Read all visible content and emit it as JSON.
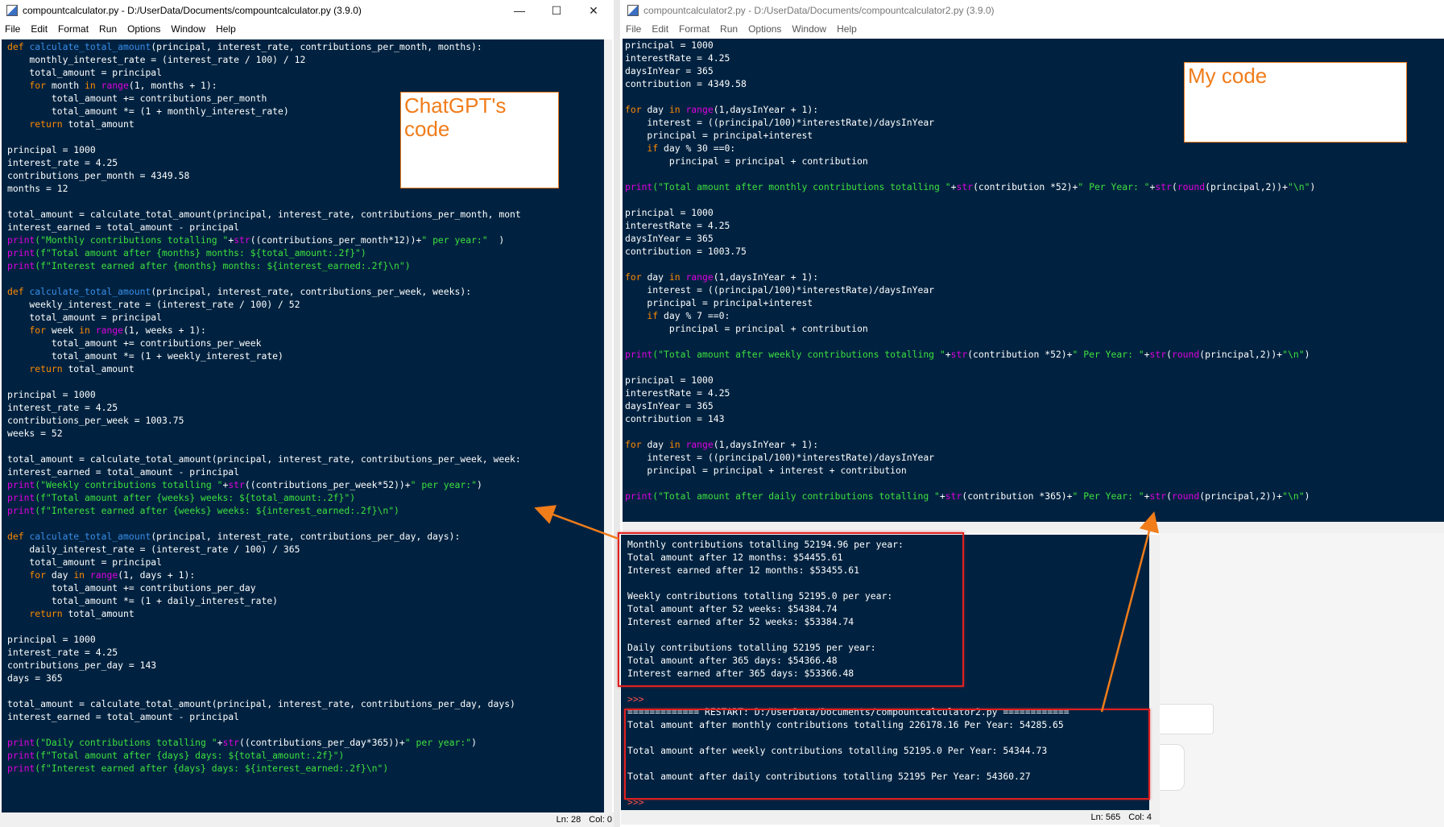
{
  "left_window": {
    "title": "compountcalculator.py - D:/UserData/Documents/compountcalculator.py (3.9.0)",
    "controls": [
      "—",
      "☐",
      "✕"
    ],
    "menu": [
      "File",
      "Edit",
      "Format",
      "Run",
      "Options",
      "Window",
      "Help"
    ],
    "status": {
      "line": "Ln: 28",
      "col": "Col: 0"
    }
  },
  "right_window": {
    "title": "compountcalculator2.py - D:/UserData/Documents/compountcalculator2.py (3.9.0)",
    "menu": [
      "File",
      "Edit",
      "Format",
      "Run",
      "Options",
      "Window",
      "Help"
    ]
  },
  "shell": {
    "status": {
      "line": "Ln: 565",
      "col": "Col: 4"
    }
  },
  "annotations": {
    "chatgpt_label": "ChatGPT's\ncode",
    "my_code_label": "My code"
  },
  "colors": {
    "editor_bg": "#002240",
    "keyword": "#ff8a00",
    "builtin": "#e000e0",
    "function": "#3a8de8",
    "string": "#3ee03e",
    "annotation": "#f07c1a",
    "highlight_box": "#e02020"
  },
  "left_code": [
    [
      [
        "kw",
        "def "
      ],
      [
        "fn",
        "calculate_total_amount"
      ],
      [
        "",
        "(principal, interest_rate, contributions_per_month, months):"
      ]
    ],
    [
      [
        "",
        "    monthly_interest_rate = (interest_rate / 100) / 12"
      ]
    ],
    [
      [
        "",
        "    total_amount = principal"
      ]
    ],
    [
      [
        "kw",
        "    for "
      ],
      [
        "",
        "month "
      ],
      [
        "kw",
        "in "
      ],
      [
        "bi",
        "range"
      ],
      [
        "",
        "(1, months + 1):"
      ]
    ],
    [
      [
        "",
        "        total_amount += contributions_per_month"
      ]
    ],
    [
      [
        "",
        "        total_amount *= (1 + monthly_interest_rate)"
      ]
    ],
    [
      [
        "kw",
        "    return "
      ],
      [
        "",
        "total_amount"
      ]
    ],
    [
      [
        "",
        ""
      ]
    ],
    [
      [
        "",
        "principal = 1000"
      ]
    ],
    [
      [
        "",
        "interest_rate = 4.25"
      ]
    ],
    [
      [
        "",
        "contributions_per_month = 4349.58"
      ]
    ],
    [
      [
        "",
        "months = 12"
      ]
    ],
    [
      [
        "",
        ""
      ]
    ],
    [
      [
        "",
        "total_amount = calculate_total_amount(principal, interest_rate, contributions_per_month, mont"
      ]
    ],
    [
      [
        "",
        "interest_earned = total_amount - principal"
      ]
    ],
    [
      [
        "bi",
        "print"
      ],
      [
        "str",
        "(\"Monthly contributions totalling \""
      ],
      [
        "",
        "+"
      ],
      [
        "bi",
        "str"
      ],
      [
        "",
        "((contributions_per_month*12))+"
      ],
      [
        "str",
        "\" per year:\""
      ],
      [
        "",
        "  )"
      ]
    ],
    [
      [
        "bi",
        "print"
      ],
      [
        "str",
        "(f\"Total amount after {months} months: ${total_amount:.2f}\")"
      ]
    ],
    [
      [
        "bi",
        "print"
      ],
      [
        "str",
        "(f\"Interest earned after {months} months: ${interest_earned:.2f}\\n\")"
      ]
    ],
    [
      [
        "",
        ""
      ]
    ],
    [
      [
        "kw",
        "def "
      ],
      [
        "fn",
        "calculate_total_amount"
      ],
      [
        "",
        "(principal, interest_rate, contributions_per_week, weeks):"
      ]
    ],
    [
      [
        "",
        "    weekly_interest_rate = (interest_rate / 100) / 52"
      ]
    ],
    [
      [
        "",
        "    total_amount = principal"
      ]
    ],
    [
      [
        "kw",
        "    for "
      ],
      [
        "",
        "week "
      ],
      [
        "kw",
        "in "
      ],
      [
        "bi",
        "range"
      ],
      [
        "",
        "(1, weeks + 1):"
      ]
    ],
    [
      [
        "",
        "        total_amount += contributions_per_week"
      ]
    ],
    [
      [
        "",
        "        total_amount *= (1 + weekly_interest_rate)"
      ]
    ],
    [
      [
        "kw",
        "    return "
      ],
      [
        "",
        "total_amount"
      ]
    ],
    [
      [
        "",
        ""
      ]
    ],
    [
      [
        "",
        "principal = 1000"
      ]
    ],
    [
      [
        "",
        "interest_rate = 4.25"
      ]
    ],
    [
      [
        "",
        "contributions_per_week = 1003.75"
      ]
    ],
    [
      [
        "",
        "weeks = 52"
      ]
    ],
    [
      [
        "",
        ""
      ]
    ],
    [
      [
        "",
        "total_amount = calculate_total_amount(principal, interest_rate, contributions_per_week, week:"
      ]
    ],
    [
      [
        "",
        "interest_earned = total_amount - principal"
      ]
    ],
    [
      [
        "bi",
        "print"
      ],
      [
        "str",
        "(\"Weekly contributions totalling \""
      ],
      [
        "",
        "+"
      ],
      [
        "bi",
        "str"
      ],
      [
        "",
        "((contributions_per_week*52))+"
      ],
      [
        "str",
        "\" per year:\""
      ],
      [
        "",
        ")"
      ]
    ],
    [
      [
        "bi",
        "print"
      ],
      [
        "str",
        "(f\"Total amount after {weeks} weeks: ${total_amount:.2f}\")"
      ]
    ],
    [
      [
        "bi",
        "print"
      ],
      [
        "str",
        "(f\"Interest earned after {weeks} weeks: ${interest_earned:.2f}\\n\")"
      ]
    ],
    [
      [
        "",
        ""
      ]
    ],
    [
      [
        "kw",
        "def "
      ],
      [
        "fn",
        "calculate_total_amount"
      ],
      [
        "",
        "(principal, interest_rate, contributions_per_day, days):"
      ]
    ],
    [
      [
        "",
        "    daily_interest_rate = (interest_rate / 100) / 365"
      ]
    ],
    [
      [
        "",
        "    total_amount = principal"
      ]
    ],
    [
      [
        "kw",
        "    for "
      ],
      [
        "",
        "day "
      ],
      [
        "kw",
        "in "
      ],
      [
        "bi",
        "range"
      ],
      [
        "",
        "(1, days + 1):"
      ]
    ],
    [
      [
        "",
        "        total_amount += contributions_per_day"
      ]
    ],
    [
      [
        "",
        "        total_amount *= (1 + daily_interest_rate)"
      ]
    ],
    [
      [
        "kw",
        "    return "
      ],
      [
        "",
        "total_amount"
      ]
    ],
    [
      [
        "",
        ""
      ]
    ],
    [
      [
        "",
        "principal = 1000"
      ]
    ],
    [
      [
        "",
        "interest_rate = 4.25"
      ]
    ],
    [
      [
        "",
        "contributions_per_day = 143"
      ]
    ],
    [
      [
        "",
        "days = 365"
      ]
    ],
    [
      [
        "",
        ""
      ]
    ],
    [
      [
        "",
        "total_amount = calculate_total_amount(principal, interest_rate, contributions_per_day, days)"
      ]
    ],
    [
      [
        "",
        "interest_earned = total_amount - principal"
      ]
    ],
    [
      [
        "",
        ""
      ]
    ],
    [
      [
        "bi",
        "print"
      ],
      [
        "str",
        "(\"Daily contributions totalling \""
      ],
      [
        "",
        "+"
      ],
      [
        "bi",
        "str"
      ],
      [
        "",
        "((contributions_per_day*365))+"
      ],
      [
        "str",
        "\" per year:\""
      ],
      [
        "",
        ")"
      ]
    ],
    [
      [
        "bi",
        "print"
      ],
      [
        "str",
        "(f\"Total amount after {days} days: ${total_amount:.2f}\")"
      ]
    ],
    [
      [
        "bi",
        "print"
      ],
      [
        "str",
        "(f\"Interest earned after {days} days: ${interest_earned:.2f}\\n\")"
      ]
    ]
  ],
  "right_code": [
    [
      [
        "",
        "principal = 1000"
      ]
    ],
    [
      [
        "",
        "interestRate = 4.25"
      ]
    ],
    [
      [
        "",
        "daysInYear = 365"
      ]
    ],
    [
      [
        "",
        "contribution = 4349.58"
      ]
    ],
    [
      [
        "",
        ""
      ]
    ],
    [
      [
        "kw",
        "for "
      ],
      [
        "",
        "day "
      ],
      [
        "kw",
        "in "
      ],
      [
        "bi",
        "range"
      ],
      [
        "",
        "(1,daysInYear + 1):"
      ]
    ],
    [
      [
        "",
        "    interest = ((principal/100)*interestRate)/daysInYear"
      ]
    ],
    [
      [
        "",
        "    principal = principal+interest"
      ]
    ],
    [
      [
        "kw",
        "    if "
      ],
      [
        "",
        "day % 30 ==0:"
      ]
    ],
    [
      [
        "",
        "        principal = principal + contribution"
      ]
    ],
    [
      [
        "",
        ""
      ]
    ],
    [
      [
        "bi",
        "print"
      ],
      [
        "str",
        "(\"Total amount after monthly contributions totalling \""
      ],
      [
        "",
        "+"
      ],
      [
        "bi",
        "str"
      ],
      [
        "",
        "(contribution *52)+"
      ],
      [
        "str",
        "\" Per Year: \""
      ],
      [
        "",
        "+"
      ],
      [
        "bi",
        "str"
      ],
      [
        "",
        "("
      ],
      [
        "bi",
        "round"
      ],
      [
        "",
        "(principal,2))+"
      ],
      [
        "str",
        "\"\\n\""
      ],
      [
        "",
        ")"
      ]
    ],
    [
      [
        "",
        ""
      ]
    ],
    [
      [
        "",
        "principal = 1000"
      ]
    ],
    [
      [
        "",
        "interestRate = 4.25"
      ]
    ],
    [
      [
        "",
        "daysInYear = 365"
      ]
    ],
    [
      [
        "",
        "contribution = 1003.75"
      ]
    ],
    [
      [
        "",
        ""
      ]
    ],
    [
      [
        "kw",
        "for "
      ],
      [
        "",
        "day "
      ],
      [
        "kw",
        "in "
      ],
      [
        "bi",
        "range"
      ],
      [
        "",
        "(1,daysInYear + 1):"
      ]
    ],
    [
      [
        "",
        "    interest = ((principal/100)*interestRate)/daysInYear"
      ]
    ],
    [
      [
        "",
        "    principal = principal+interest"
      ]
    ],
    [
      [
        "kw",
        "    if "
      ],
      [
        "",
        "day % 7 ==0:"
      ]
    ],
    [
      [
        "",
        "        principal = principal + contribution"
      ]
    ],
    [
      [
        "",
        ""
      ]
    ],
    [
      [
        "bi",
        "print"
      ],
      [
        "str",
        "(\"Total amount after weekly contributions totalling \""
      ],
      [
        "",
        "+"
      ],
      [
        "bi",
        "str"
      ],
      [
        "",
        "(contribution *52)+"
      ],
      [
        "str",
        "\" Per Year: \""
      ],
      [
        "",
        "+"
      ],
      [
        "bi",
        "str"
      ],
      [
        "",
        "("
      ],
      [
        "bi",
        "round"
      ],
      [
        "",
        "(principal,2))+"
      ],
      [
        "str",
        "\"\\n\""
      ],
      [
        "",
        ")"
      ]
    ],
    [
      [
        "",
        ""
      ]
    ],
    [
      [
        "",
        "principal = 1000"
      ]
    ],
    [
      [
        "",
        "interestRate = 4.25"
      ]
    ],
    [
      [
        "",
        "daysInYear = 365"
      ]
    ],
    [
      [
        "",
        "contribution = 143"
      ]
    ],
    [
      [
        "",
        ""
      ]
    ],
    [
      [
        "kw",
        "for "
      ],
      [
        "",
        "day "
      ],
      [
        "kw",
        "in "
      ],
      [
        "bi",
        "range"
      ],
      [
        "",
        "(1,daysInYear + 1):"
      ]
    ],
    [
      [
        "",
        "    interest = ((principal/100)*interestRate)/daysInYear"
      ]
    ],
    [
      [
        "",
        "    principal = principal + interest + contribution"
      ]
    ],
    [
      [
        "",
        ""
      ]
    ],
    [
      [
        "bi",
        "print"
      ],
      [
        "str",
        "(\"Total amount after daily contributions totalling \""
      ],
      [
        "",
        "+"
      ],
      [
        "bi",
        "str"
      ],
      [
        "",
        "(contribution *365)+"
      ],
      [
        "str",
        "\" Per Year: \""
      ],
      [
        "",
        "+"
      ],
      [
        "bi",
        "str"
      ],
      [
        "",
        "("
      ],
      [
        "bi",
        "round"
      ],
      [
        "",
        "(principal,2))+"
      ],
      [
        "str",
        "\"\\n\""
      ],
      [
        "",
        ")"
      ]
    ]
  ],
  "shell_output": [
    "Monthly contributions totalling 52194.96 per year:",
    "Total amount after 12 months: $54455.61",
    "Interest earned after 12 months: $53455.61",
    "",
    "Weekly contributions totalling 52195.0 per year:",
    "Total amount after 52 weeks: $54384.74",
    "Interest earned after 52 weeks: $53384.74",
    "",
    "Daily contributions totalling 52195 per year:",
    "Total amount after 365 days: $54366.48",
    "Interest earned after 365 days: $53366.48",
    "",
    ">>> ",
    "============= RESTART: D:/UserData/Documents/compountcalculator2.py ============",
    "Total amount after monthly contributions totalling 226178.16 Per Year: 54285.65",
    "",
    "Total amount after weekly contributions totalling 52195.0 Per Year: 54344.73",
    "",
    "Total amount after daily contributions totalling 52195 Per Year: 54360.27",
    "",
    ">>> "
  ]
}
